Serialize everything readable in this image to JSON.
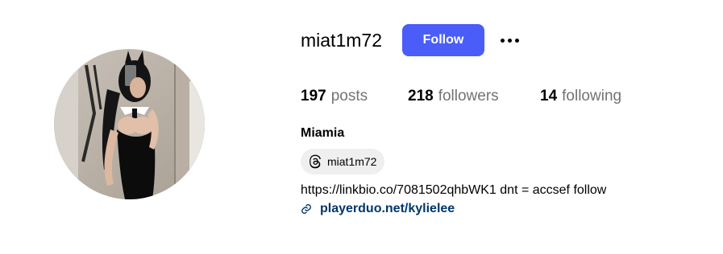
{
  "colors": {
    "accent": "#4a5df9",
    "link": "#00376b",
    "muted": "#737373",
    "chip_bg": "#efefef"
  },
  "profile": {
    "username": "miat1m72",
    "full_name": "Miamia",
    "follow_label": "Follow",
    "more_icon": "more-horizontal-icon",
    "avatar_icon": "profile-photo"
  },
  "stats": {
    "posts": {
      "count": "197",
      "label": "posts"
    },
    "followers": {
      "count": "218",
      "label": "followers"
    },
    "following": {
      "count": "14",
      "label": "following"
    }
  },
  "threads": {
    "icon": "threads-icon",
    "handle": "miat1m72"
  },
  "bio": {
    "text": "https://linkbio.co/7081502qhbWK1 dnt = accsef follow",
    "link_icon": "link-icon",
    "link_text": "playerduo.net/kylielee"
  }
}
